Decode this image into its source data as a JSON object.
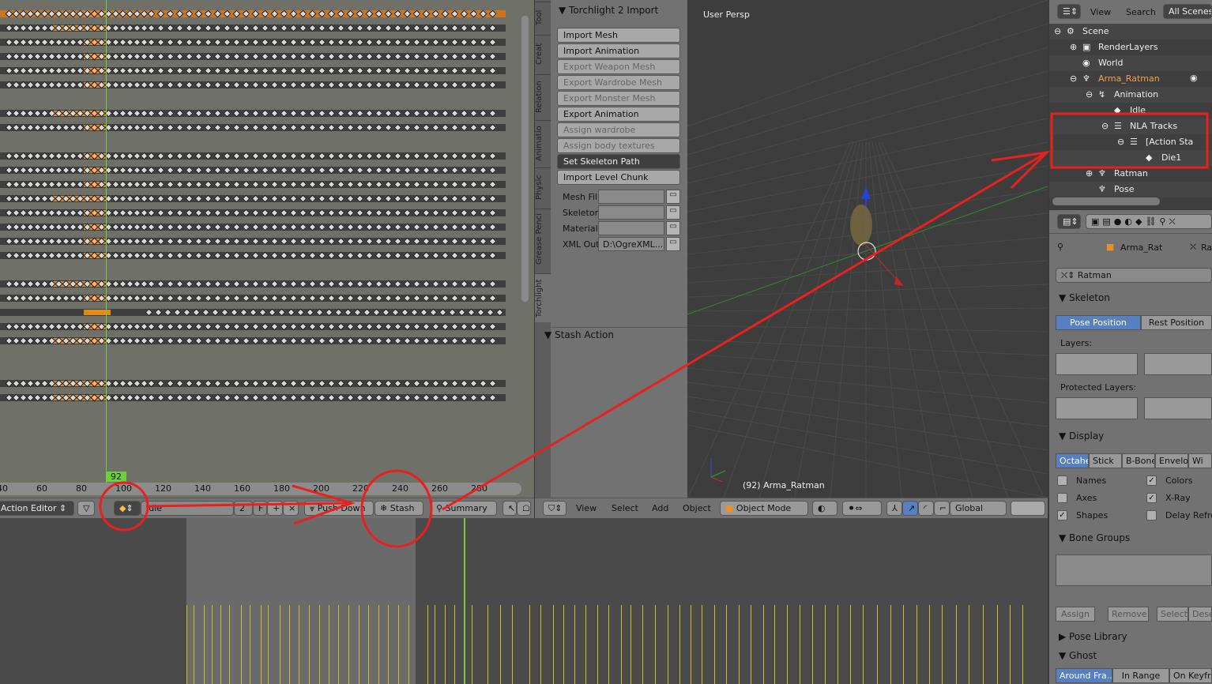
{
  "dopesheet": {
    "current_frame": "92",
    "ruler_ticks": [
      "40",
      "60",
      "80",
      "100",
      "120",
      "140",
      "160",
      "180",
      "200",
      "220",
      "240",
      "260",
      "280"
    ],
    "header": {
      "editor_mode": "Action Editor",
      "action_name": "Idle",
      "users": "2",
      "fake_user": "F",
      "push_down": "Push Down",
      "stash": "Stash",
      "summary": "Summary"
    }
  },
  "tool_tabs": [
    "Tool",
    "Creat",
    "Relation",
    "Animatio",
    "Physic",
    "Grease Penci",
    "Torchlight"
  ],
  "torchlight_panel": {
    "title": "Torchlight 2 Import",
    "buttons": [
      {
        "label": "Import Mesh",
        "state": "enabled"
      },
      {
        "label": "Import Animation",
        "state": "enabled"
      },
      {
        "label": "Export Weapon Mesh",
        "state": "disabled"
      },
      {
        "label": "Export Wardrobe Mesh",
        "state": "disabled"
      },
      {
        "label": "Export Monster Mesh",
        "state": "disabled"
      },
      {
        "label": "Export Animation",
        "state": "enabled"
      },
      {
        "label": "Assign wardrobe textures",
        "state": "disabled"
      },
      {
        "label": "Assign body textures",
        "state": "disabled"
      },
      {
        "label": "Set Skeleton Path",
        "state": "dark"
      },
      {
        "label": "Import Level Chunk",
        "state": "enabled"
      }
    ],
    "fields": [
      {
        "label": "Mesh Fil",
        "value": ""
      },
      {
        "label": "Skeleton",
        "value": ""
      },
      {
        "label": "Material",
        "value": ""
      },
      {
        "label": "XML Out",
        "value": "D:\\OgreXML..."
      }
    ],
    "stash_title": "Stash Action"
  },
  "viewport": {
    "label": "User Persp",
    "object_info": "(92) Arma_Ratman",
    "header": {
      "menus": [
        "View",
        "Select",
        "Add",
        "Object"
      ],
      "mode": "Object Mode",
      "orientation": "Global"
    }
  },
  "outliner": {
    "header": {
      "view": "View",
      "search": "Search",
      "scenes": "All Scenes"
    },
    "items": [
      {
        "label": "Scene",
        "indent": 0
      },
      {
        "label": "RenderLayers",
        "indent": 1
      },
      {
        "label": "World",
        "indent": 1
      },
      {
        "label": "Arma_Ratman",
        "indent": 1
      },
      {
        "label": "Animation",
        "indent": 2
      },
      {
        "label": "Idle",
        "indent": 3
      },
      {
        "label": "NLA Tracks",
        "indent": 3
      },
      {
        "label": "[Action Sta",
        "indent": 4
      },
      {
        "label": "Die1",
        "indent": 5
      },
      {
        "label": "Ratman",
        "indent": 2
      },
      {
        "label": "Pose",
        "indent": 2
      }
    ]
  },
  "properties": {
    "breadcrumb": [
      "Arma_Rat",
      "Ra"
    ],
    "armature_name": "Ratman",
    "skeleton": {
      "title": "Skeleton",
      "pose_position": "Pose Position",
      "rest_position": "Rest Position",
      "layers": "Layers:",
      "protected_layers": "Protected Layers:"
    },
    "display": {
      "title": "Display",
      "types": [
        "Octahe",
        "Stick",
        "B-Bone",
        "Envelop",
        "Wi"
      ],
      "options": [
        {
          "label": "Names",
          "checked": false
        },
        {
          "label": "Colors",
          "checked": true
        },
        {
          "label": "Axes",
          "checked": false
        },
        {
          "label": "X-Ray",
          "checked": true
        },
        {
          "label": "Shapes",
          "checked": true
        },
        {
          "label": "Delay Refre",
          "checked": false
        }
      ]
    },
    "bone_groups": {
      "title": "Bone Groups",
      "buttons": [
        "Assign",
        "Remove",
        "Select",
        "Desele"
      ]
    },
    "pose_library": "Pose Library",
    "ghost": {
      "title": "Ghost",
      "types": [
        "Around Fra...",
        "In Range",
        "On Keyfra"
      ]
    }
  },
  "colors": {
    "keyframe_selected": "#e08a1a",
    "current_frame": "#6cd13c",
    "annotation": "#e8201e",
    "selection": "#5680c2"
  }
}
